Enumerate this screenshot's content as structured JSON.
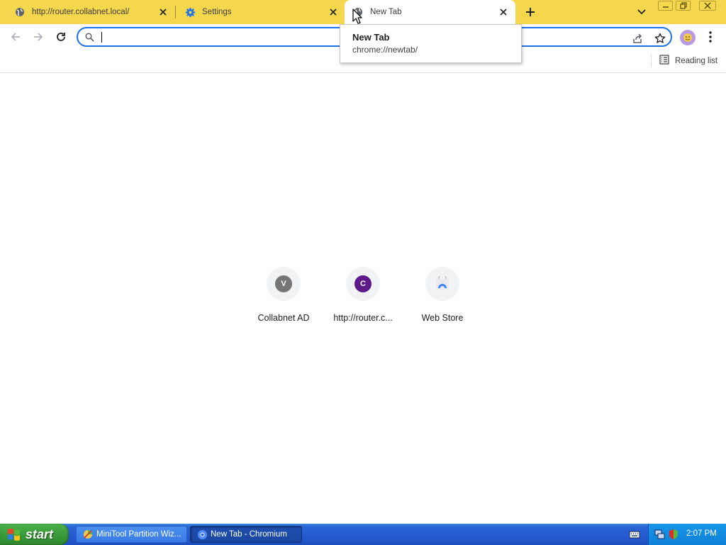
{
  "colors": {
    "tabstrip": "#f5d74e",
    "accent": "#1a73e8",
    "taskbar": "#245ad0",
    "start_green": "#3a9a3a"
  },
  "tabs": [
    {
      "title": "http://router.collabnet.local/",
      "icon": "globe-icon",
      "active": false
    },
    {
      "title": "Settings",
      "icon": "gear-icon",
      "active": false
    },
    {
      "title": "New Tab",
      "icon": "globe-icon",
      "active": true
    }
  ],
  "omnibox": {
    "value": "",
    "placeholder": ""
  },
  "bookmarks_bar": {
    "reading_list_label": "Reading list"
  },
  "hovercard": {
    "title": "New Tab",
    "url": "chrome://newtab/"
  },
  "shortcuts": [
    {
      "letter": "V",
      "label": "Collabnet AD",
      "color": "#757575"
    },
    {
      "letter": "C",
      "label": "http://router.c...",
      "color": "#5f1a8a"
    },
    {
      "letter": "",
      "label": "Web Store",
      "icon": "webstore-icon"
    }
  ],
  "taskbar": {
    "start_label": "start",
    "items": [
      {
        "label": "MiniTool Partition Wiz...",
        "icon": "minitool-icon",
        "active": false
      },
      {
        "label": "New Tab - Chromium",
        "icon": "chromium-icon",
        "active": true
      }
    ],
    "clock": "2:07 PM"
  }
}
